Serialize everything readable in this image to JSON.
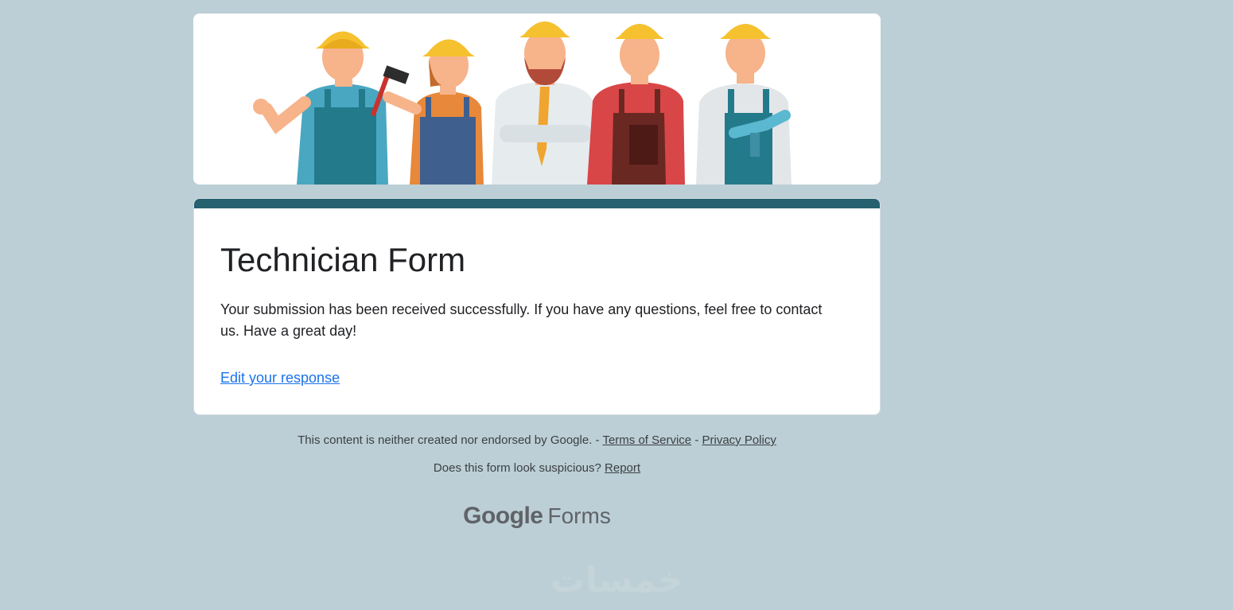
{
  "form": {
    "title": "Technician Form",
    "confirmation_message": "Your submission has been received successfully. If you have any questions, feel free to contact us. Have a great day!",
    "edit_link": "Edit your response",
    "accent_color": "#25616f",
    "background_color": "#bccfd6"
  },
  "footer": {
    "disclaimer": "This content is neither created nor endorsed by Google. -",
    "terms_link": "Terms of Service",
    "separator": "-",
    "privacy_link": "Privacy Policy",
    "suspicious_text": "Does this form look suspicious?",
    "report_link": "Report",
    "brand_google": "Google",
    "brand_forms": "Forms"
  },
  "watermark": {
    "text": "خمسات"
  },
  "banner": {
    "image": "five cartoon construction workers with yellow hard hats",
    "icons": [
      "worker-thumbs-up-icon",
      "worker-hammer-icon",
      "worker-bearded-tie-icon",
      "worker-red-apron-icon",
      "worker-drill-icon"
    ]
  }
}
